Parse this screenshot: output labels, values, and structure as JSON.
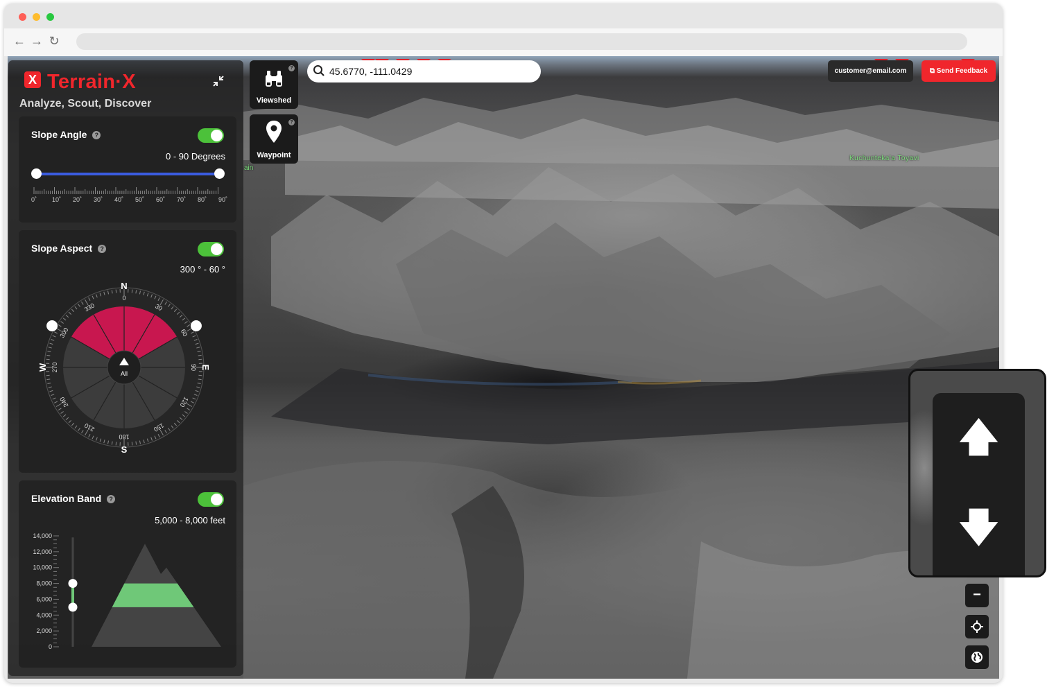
{
  "app": {
    "brand_mark": "X",
    "name": "Terrain·X",
    "tagline": "Analyze, Scout, Discover"
  },
  "colors": {
    "brand_red": "#f0262c",
    "toggle_green": "#4cc13a",
    "slider_blue": "#3b5ce0",
    "aspect_pink": "#c8174f",
    "elevation_green": "#6fc878"
  },
  "search": {
    "value": "45.6770, -111.0429",
    "icon": "search-icon"
  },
  "tools": {
    "viewshed_label": "Viewshed",
    "waypoint_label": "Waypoint",
    "help_glyph": "?"
  },
  "account": {
    "email": "customer@email.com",
    "feedback_label": "Send Feedback"
  },
  "map": {
    "place_label": "Kuchunteka'a Toyavi",
    "partial_label": "ain"
  },
  "slope_angle": {
    "title": "Slope Angle",
    "enabled": true,
    "range_text": "0 - 90 Degrees",
    "min": 0,
    "max": 90,
    "tick_labels": [
      "0˚",
      "10˚",
      "20˚",
      "30˚",
      "40˚",
      "50˚",
      "60˚",
      "70˚",
      "80˚",
      "90˚"
    ]
  },
  "slope_aspect": {
    "title": "Slope Aspect",
    "enabled": true,
    "range_text": "300 ° - 60 °",
    "from_deg": 300,
    "to_deg": 60,
    "center_label": "All",
    "cardinals": {
      "n": "N",
      "e": "E",
      "s": "S",
      "w": "W"
    },
    "degree_labels": [
      "0",
      "30",
      "60",
      "90",
      "120",
      "150",
      "180",
      "210",
      "240",
      "270",
      "300",
      "330"
    ]
  },
  "elevation_band": {
    "title": "Elevation Band",
    "enabled": true,
    "range_text": "5,000 - 8,000 feet",
    "band_low": 5000,
    "band_high": 8000,
    "axis_labels": [
      "14,000",
      "12,000",
      "10,000",
      "8,000",
      "6,000",
      "4,000",
      "2,000",
      "0"
    ]
  },
  "controls": {
    "zoom_out": "−",
    "zoom_up_arrow": "🡅",
    "zoom_down_arrow": "🡇"
  }
}
